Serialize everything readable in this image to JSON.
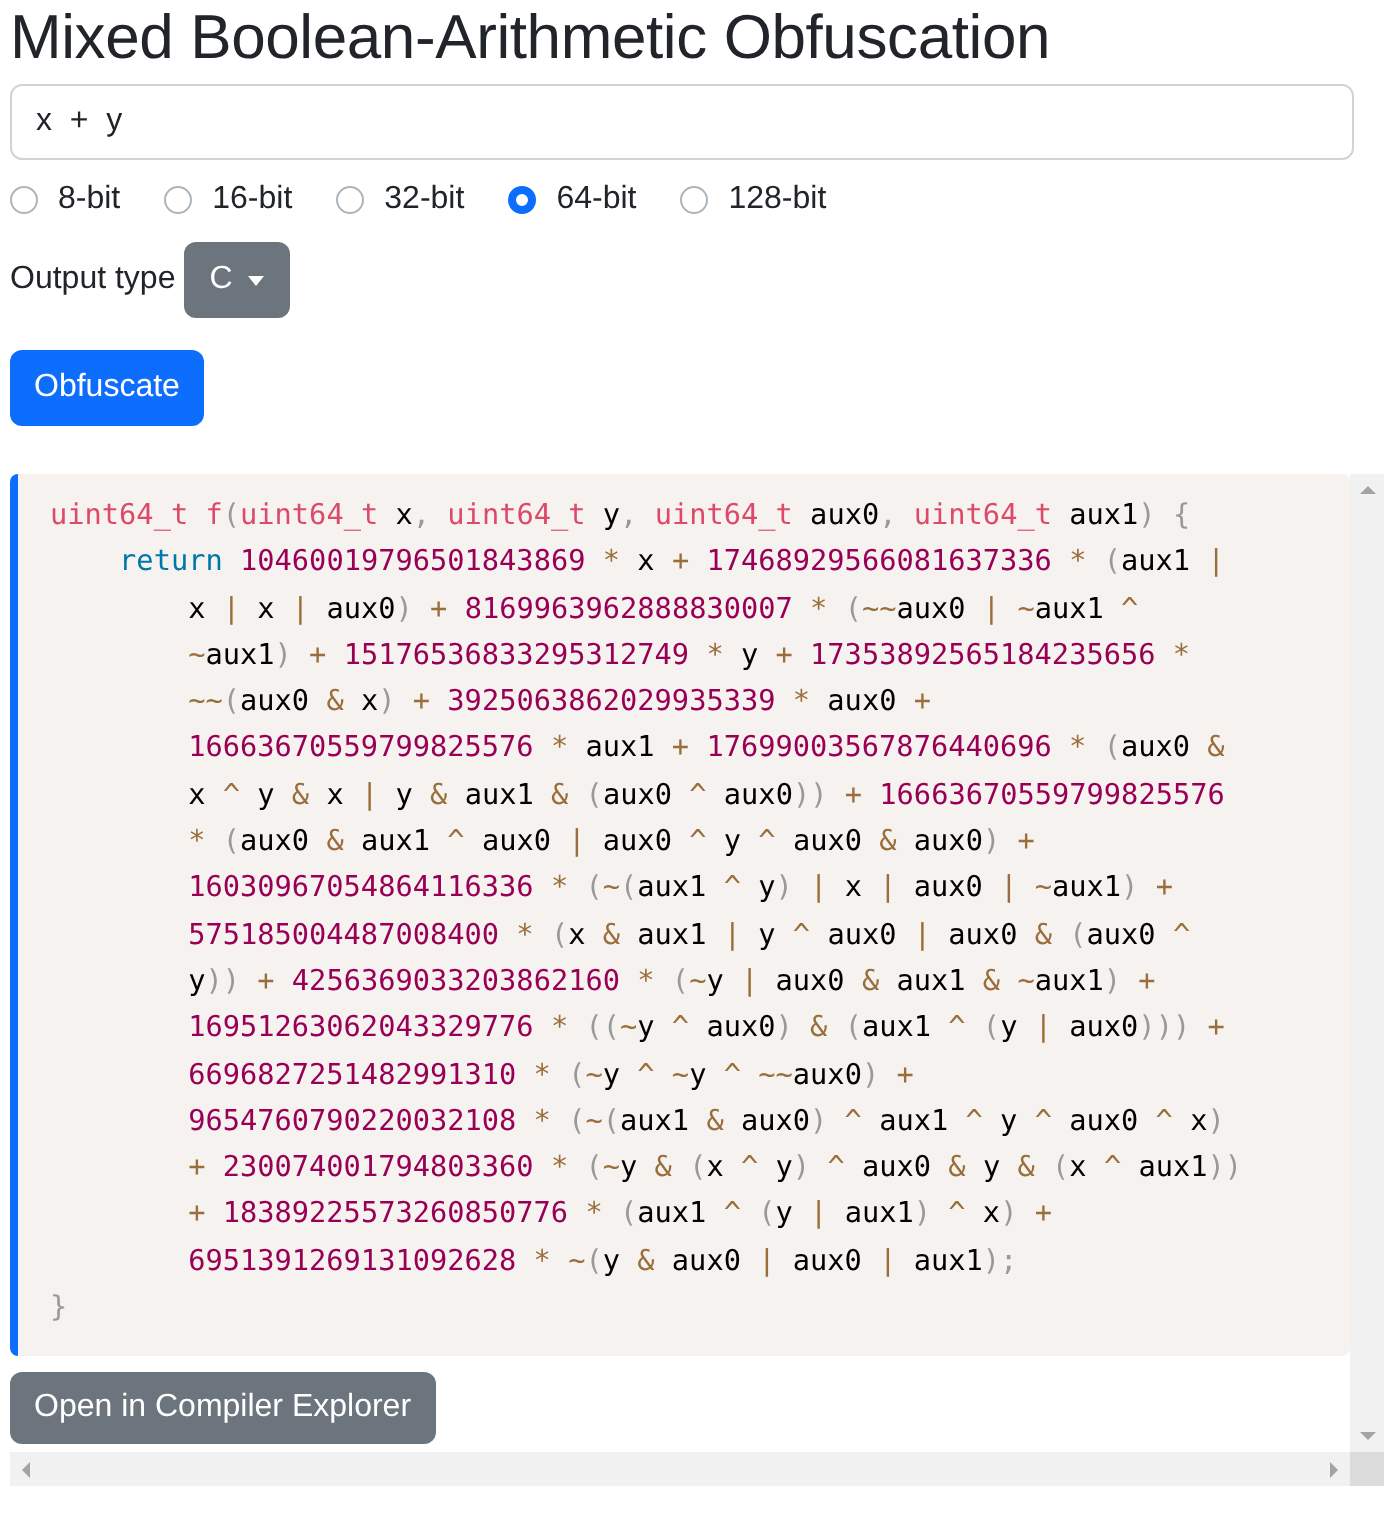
{
  "title": "Mixed Boolean-Arithmetic Obfuscation",
  "expression_input": {
    "value": "x  +  y"
  },
  "bit_widths": [
    {
      "label": "8-bit",
      "selected": false
    },
    {
      "label": "16-bit",
      "selected": false
    },
    {
      "label": "32-bit",
      "selected": false
    },
    {
      "label": "64-bit",
      "selected": true
    },
    {
      "label": "128-bit",
      "selected": false
    }
  ],
  "output_type": {
    "label": "Output type",
    "value": "C"
  },
  "obfuscate_button": "Obfuscate",
  "code": {
    "signature": [
      {
        "kind": "type",
        "text": "uint64_t"
      },
      {
        "kind": "function",
        "text": " f"
      },
      {
        "kind": "punct",
        "text": "("
      },
      {
        "kind": "type",
        "text": "uint64_t"
      },
      {
        "kind": "plain",
        "text": " x"
      },
      {
        "kind": "punct",
        "text": ", "
      },
      {
        "kind": "type",
        "text": "uint64_t"
      },
      {
        "kind": "plain",
        "text": " y"
      },
      {
        "kind": "punct",
        "text": ", "
      },
      {
        "kind": "type",
        "text": "uint64_t"
      },
      {
        "kind": "plain",
        "text": " aux0"
      },
      {
        "kind": "punct",
        "text": ", "
      },
      {
        "kind": "type",
        "text": "uint64_t"
      },
      {
        "kind": "plain",
        "text": " aux1"
      },
      {
        "kind": "punct",
        "text": ") {"
      }
    ],
    "keyword": "return",
    "expression": "10460019796501843869 * x + 17468929566081637336 * (aux1 | x | x | aux0) + 8169963962888830007 * (~~aux0 | ~aux1 ^ ~aux1) + 15176536833295312749 * y + 17353892565184235656 * ~~(aux0 & x) + 3925063862029935339 * aux0 + 16663670559799825576 * aux1 + 17699003567876440696 * (aux0 & x ^ y & x | y & aux1 & (aux0 ^ aux0)) + 16663670559799825576 * (aux0 & aux1 ^ aux0 | aux0 ^ y ^ aux0 & aux0) + 16030967054864116336 * (~(aux1 ^ y) | x | aux0 | ~aux1) + 575185004487008400 * (x & aux1 | y ^ aux0 | aux0 & (aux0 ^ y)) + 4256369033203862160 * (~y | aux0 & aux1 & ~aux1) + 16951263062043329776 * ((~y ^ aux0) & (aux1 ^ (y | aux0))) + 6696827251482991310 * (~y ^ ~y ^ ~~aux0) + 9654760790220032108 * (~(aux1 & aux0) ^ aux1 ^ y ^ aux0 ^ x) + 230074001794803360 * (~y & (x ^ y) ^ aux0 & y & (x ^ aux1)) + 18389225573260850776 * (aux1 ^ (y | aux1) ^ x) + 6951391269131092628 * ~(y & aux0 | aux0 | aux1);",
    "closing": "}"
  },
  "open_button": "Open in Compiler Explorer"
}
